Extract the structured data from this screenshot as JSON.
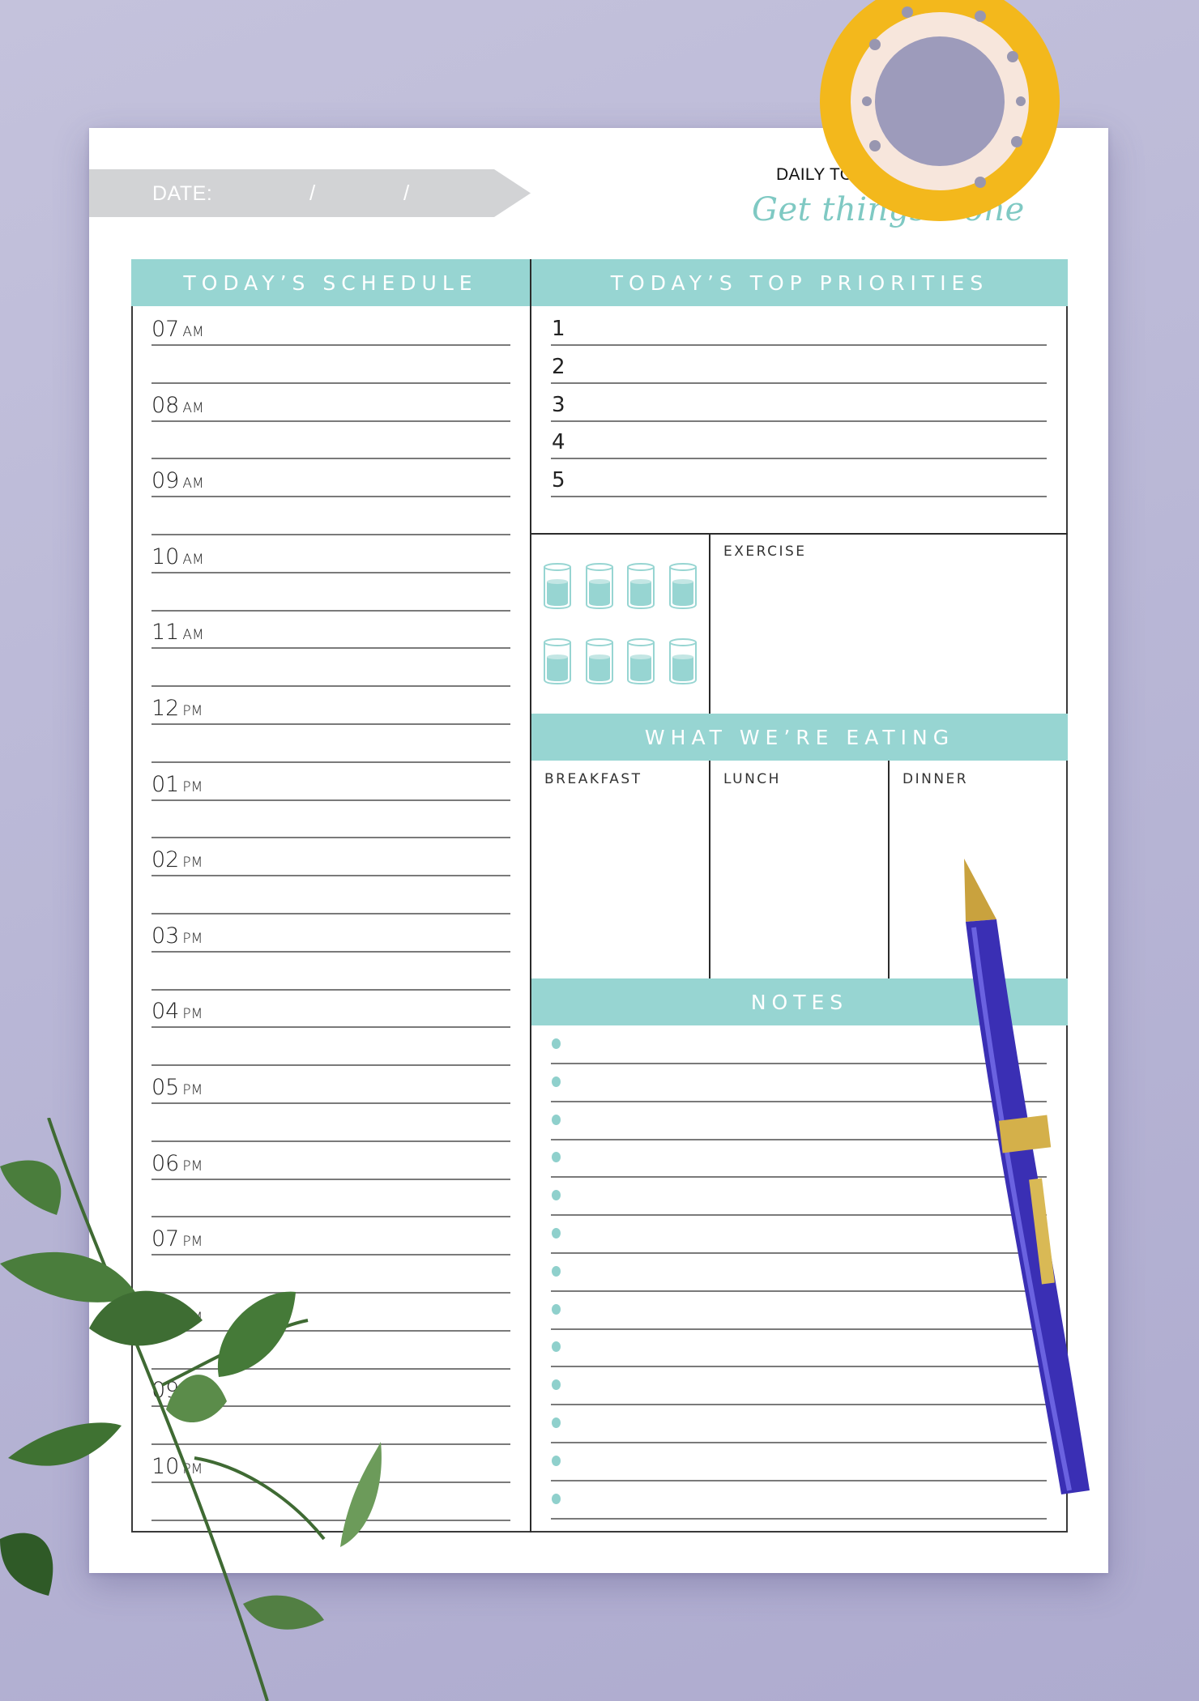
{
  "header": {
    "date_label": "DATE:",
    "date_separators": [
      "/",
      "/"
    ],
    "title": "DAILY TO DO",
    "subtitle": "Get things Done"
  },
  "schedule": {
    "title": "TODAY’S SCHEDULE",
    "slots": [
      {
        "hour": "07",
        "period": "AM"
      },
      {
        "hour": "08",
        "period": "AM"
      },
      {
        "hour": "09",
        "period": "AM"
      },
      {
        "hour": "10",
        "period": "AM"
      },
      {
        "hour": "11",
        "period": "AM"
      },
      {
        "hour": "12",
        "period": "PM"
      },
      {
        "hour": "01",
        "period": "PM"
      },
      {
        "hour": "02",
        "period": "PM"
      },
      {
        "hour": "03",
        "period": "PM"
      },
      {
        "hour": "04",
        "period": "PM"
      },
      {
        "hour": "05",
        "period": "PM"
      },
      {
        "hour": "06",
        "period": "PM"
      },
      {
        "hour": "07",
        "period": "PM"
      },
      {
        "hour": "08",
        "period": "PM"
      },
      {
        "hour": "09",
        "period": "PM"
      },
      {
        "hour": "10",
        "period": "PM"
      }
    ]
  },
  "priorities": {
    "title": "TODAY’S TOP PRIORITIES",
    "items": [
      "1",
      "2",
      "3",
      "4",
      "5"
    ]
  },
  "water_tracker": {
    "glasses_total": 8,
    "icon": "water-glass-icon"
  },
  "exercise": {
    "label": "EXERCISE"
  },
  "meals": {
    "title": "WHAT WE’RE EATING",
    "columns": [
      "BREAKFAST",
      "LUNCH",
      "DINNER"
    ]
  },
  "notes": {
    "title": "NOTES",
    "bullet_count": 13
  },
  "colors": {
    "accent": "#97d5d2",
    "script": "#7fc9c3",
    "date_banner": "#d2d3d5",
    "background": "#b9b7d6"
  }
}
